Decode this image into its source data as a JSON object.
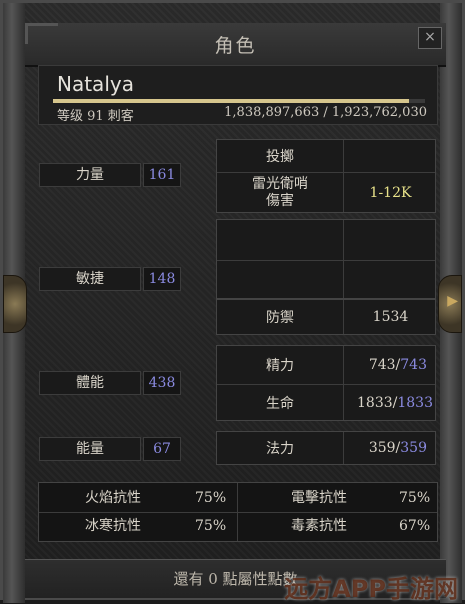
{
  "window": {
    "title": "角色",
    "close_label": "×"
  },
  "character": {
    "name": "Natalya",
    "level_line": "等级 91 刺客",
    "experience": "1,838,897,663 / 1,923,762,030",
    "xp_progress": 0.956
  },
  "stats": [
    {
      "label": "力量",
      "value": "161"
    },
    {
      "label": "敏捷",
      "value": "148"
    },
    {
      "label": "體能",
      "value": "438"
    },
    {
      "label": "能量",
      "value": "67"
    }
  ],
  "combat": {
    "throw_label": "投擲",
    "lightning_label": "雷光衛哨\n傷害",
    "lightning_value": "1-12K",
    "defense_label": "防禦",
    "defense_value": "1534"
  },
  "vitals": {
    "stamina_label": "精力",
    "stamina_current": "743",
    "stamina_max": "743",
    "life_label": "生命",
    "life_current": "1833",
    "life_max": "1833",
    "mana_label": "法力",
    "mana_current": "359",
    "mana_max": "359",
    "separator": "/"
  },
  "resistances": {
    "fire_label": "火焰抗性",
    "fire_value": "75%",
    "lightning_label": "電擊抗性",
    "lightning_value": "75%",
    "cold_label": "冰寒抗性",
    "cold_value": "75%",
    "poison_label": "毒素抗性",
    "poison_value": "67%"
  },
  "footer": {
    "points_text": "還有 0 點屬性點數"
  },
  "watermark": "远方APP手游网",
  "colors": {
    "stat_value": "#8a8ae0",
    "max_value": "#8a8ae0",
    "lightning_value": "#e8e28a"
  }
}
